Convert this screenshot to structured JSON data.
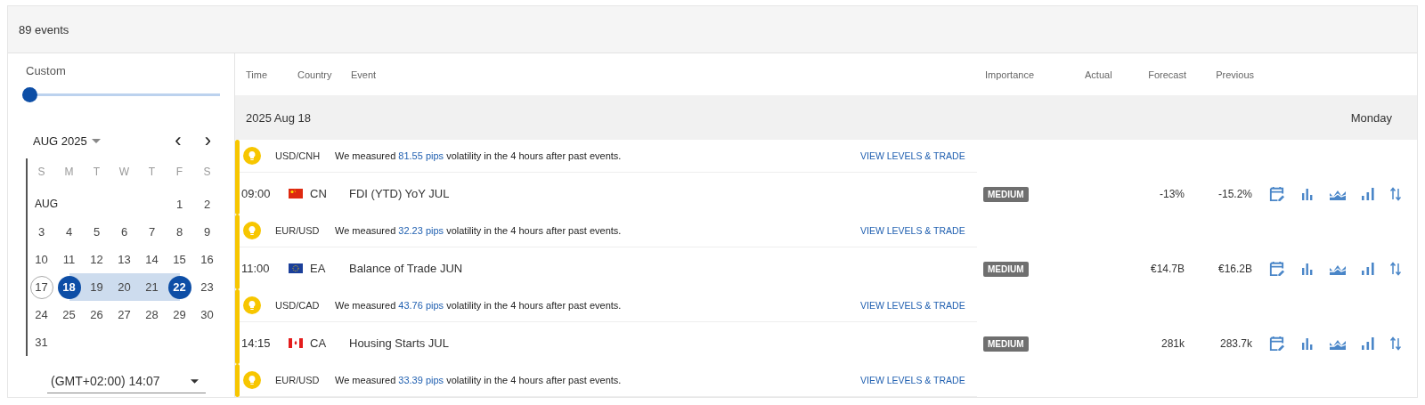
{
  "header": {
    "count": "89 events"
  },
  "sidebar": {
    "range_label": "Custom",
    "slider": {
      "level": 0
    },
    "calendar": {
      "month": "AUG 2025",
      "prev": "‹",
      "next": "›",
      "weekdays": [
        "S",
        "M",
        "T",
        "W",
        "T",
        "F",
        "S"
      ],
      "month_label": "AUG",
      "weeks": [
        [
          {
            "day": "1",
            "selected": false,
            "in_range": false,
            "today": false
          },
          {
            "day": "2",
            "selected": false,
            "in_range": false,
            "today": false
          }
        ],
        [
          {
            "day": "3",
            "selected": false,
            "in_range": false,
            "today": false
          },
          {
            "day": "4",
            "selected": false,
            "in_range": false,
            "today": false
          },
          {
            "day": "5",
            "selected": false,
            "in_range": false,
            "today": false
          },
          {
            "day": "6",
            "selected": false,
            "in_range": false,
            "today": false
          },
          {
            "day": "7",
            "selected": false,
            "in_range": false,
            "today": false
          },
          {
            "day": "8",
            "selected": false,
            "in_range": false,
            "today": false
          },
          {
            "day": "9",
            "selected": false,
            "in_range": false,
            "today": false
          }
        ],
        [
          {
            "day": "10",
            "selected": false,
            "in_range": false,
            "today": false
          },
          {
            "day": "11",
            "selected": false,
            "in_range": false,
            "today": false
          },
          {
            "day": "12",
            "selected": false,
            "in_range": false,
            "today": false
          },
          {
            "day": "13",
            "selected": false,
            "in_range": false,
            "today": false
          },
          {
            "day": "14",
            "selected": false,
            "in_range": false,
            "today": false
          },
          {
            "day": "15",
            "selected": false,
            "in_range": false,
            "today": false
          },
          {
            "day": "16",
            "selected": false,
            "in_range": false,
            "today": false
          }
        ],
        [
          {
            "day": "17",
            "selected": false,
            "in_range": false,
            "today": true
          },
          {
            "day": "18",
            "selected": true,
            "in_range": true,
            "today": false
          },
          {
            "day": "19",
            "selected": false,
            "in_range": true,
            "today": false
          },
          {
            "day": "20",
            "selected": false,
            "in_range": true,
            "today": false
          },
          {
            "day": "21",
            "selected": false,
            "in_range": true,
            "today": false
          },
          {
            "day": "22",
            "selected": true,
            "in_range": true,
            "today": false
          },
          {
            "day": "23",
            "selected": false,
            "in_range": false,
            "today": false
          }
        ],
        [
          {
            "day": "24",
            "selected": false,
            "in_range": false,
            "today": false
          },
          {
            "day": "25",
            "selected": false,
            "in_range": false,
            "today": false
          },
          {
            "day": "26",
            "selected": false,
            "in_range": false,
            "today": false
          },
          {
            "day": "27",
            "selected": false,
            "in_range": false,
            "today": false
          },
          {
            "day": "28",
            "selected": false,
            "in_range": false,
            "today": false
          },
          {
            "day": "29",
            "selected": false,
            "in_range": false,
            "today": false
          },
          {
            "day": "30",
            "selected": false,
            "in_range": false,
            "today": false
          }
        ],
        [
          {
            "day": "31",
            "selected": false,
            "in_range": false,
            "today": false
          }
        ]
      ]
    },
    "timezone": "(GMT+02:00) 14:07"
  },
  "table": {
    "columns": [
      "Time",
      "Country",
      "Event",
      "Importance",
      "Actual",
      "Forecast",
      "Previous"
    ],
    "date_header": {
      "date": "2025 Aug 18",
      "weekday": "Monday"
    },
    "groups": [
      {
        "volatility": {
          "pair": "USD/CNH",
          "before": "We measured ",
          "pips": "81.55 pips",
          "after": " volatility in the 4 hours after past events.",
          "link": "VIEW LEVELS & TRADE"
        },
        "event": {
          "time": "09:00",
          "flag": {
            "kind": "china"
          },
          "country": "CN",
          "name": "FDI (YTD) YoY JUL",
          "importance": "MEDIUM",
          "forecast": "-13%",
          "previous": "-15.2%"
        }
      },
      {
        "volatility": {
          "pair": "EUR/USD",
          "before": "We measured ",
          "pips": "32.23 pips",
          "after": " volatility in the 4 hours after past events.",
          "link": "VIEW LEVELS & TRADE"
        },
        "event": {
          "time": "11:00",
          "flag": {
            "kind": "eu"
          },
          "country": "EA",
          "name": "Balance of Trade JUN",
          "importance": "MEDIUM",
          "forecast": "€14.7B",
          "previous": "€16.2B"
        }
      },
      {
        "volatility": {
          "pair": "USD/CAD",
          "before": "We measured ",
          "pips": "43.76 pips",
          "after": " volatility in the 4 hours after past events.",
          "link": "VIEW LEVELS & TRADE"
        },
        "event": {
          "time": "14:15",
          "flag": {
            "kind": "canada"
          },
          "country": "CA",
          "name": "Housing Starts JUL",
          "importance": "MEDIUM",
          "forecast": "281k",
          "previous": "283.7k"
        }
      },
      {
        "volatility": {
          "pair": "EUR/USD",
          "before": "We measured ",
          "pips": "33.39 pips",
          "after": " volatility in the 4 hours after past events.",
          "link": "VIEW LEVELS & TRADE"
        }
      }
    ]
  }
}
